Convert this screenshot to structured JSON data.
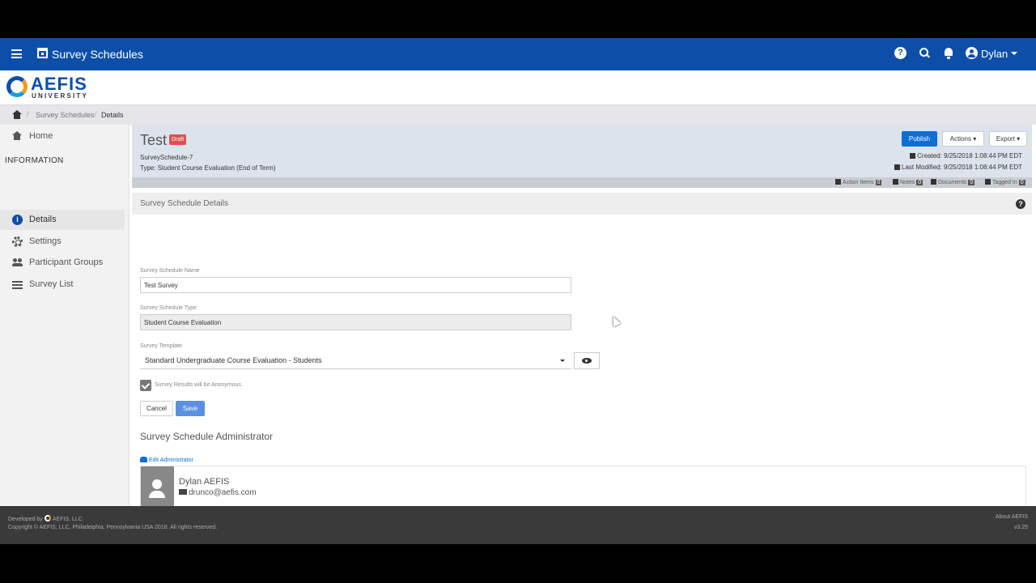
{
  "topbar": {
    "title": "Survey Schedules",
    "user": "Dylan",
    "help_glyph": "?"
  },
  "logo": {
    "name": "AEFIS",
    "sub": "UNIVERSITY"
  },
  "breadcrumb": {
    "items": [
      "Survey Schedules",
      "Details"
    ],
    "separator": "/"
  },
  "sidebar": {
    "home": "Home",
    "section": "INFORMATION",
    "items": [
      "Details",
      "Settings",
      "Participant Groups",
      "Survey List"
    ],
    "info_glyph": "i"
  },
  "record": {
    "title": "Test",
    "status": "Draft",
    "id": "SurveySchedule-7",
    "type": "Type: Student Course Evaluation (End of Term)",
    "created": "Created: 9/25/2018 1:08:44 PM EDT",
    "modified": "Last Modified: 9/25/2018 1:08:44 PM EDT"
  },
  "header_buttons": {
    "publish": "Publish",
    "actions": "Actions ▾",
    "export": "Export ▾"
  },
  "status_counts": [
    {
      "label": "Action Items",
      "count": "0"
    },
    {
      "label": "Notes",
      "count": "0"
    },
    {
      "label": "Documents",
      "count": "0"
    },
    {
      "label": "Tagged In",
      "count": "0"
    }
  ],
  "details": {
    "section_title": "Survey Schedule Details",
    "help_glyph": "?",
    "name_label": "Survey Schedule Name",
    "name_value": "Test Survey",
    "type_label": "Survey Schedule Type",
    "type_value": "Student Course Evaluation",
    "template_label": "Survey Template",
    "template_value": "Standard Undergraduate Course Evaluation - Students",
    "anonymous_label": "Survey Results will be Anonymous",
    "cancel": "Cancel",
    "save": "Save"
  },
  "admin": {
    "title": "Survey Schedule Administrator",
    "edit_label": "Edit Administrator",
    "name": "Dylan AEFIS",
    "email": "drunco@aefis.com"
  },
  "footer": {
    "developed_by": "Developed by",
    "company": "AEFIS, LLC",
    "copyright": "Copyright © AEFIS, LLC, Philadelphia, Pennsylvania USA 2018. All rights reserved.",
    "about": "About AEFIS",
    "version": "v3.25"
  }
}
